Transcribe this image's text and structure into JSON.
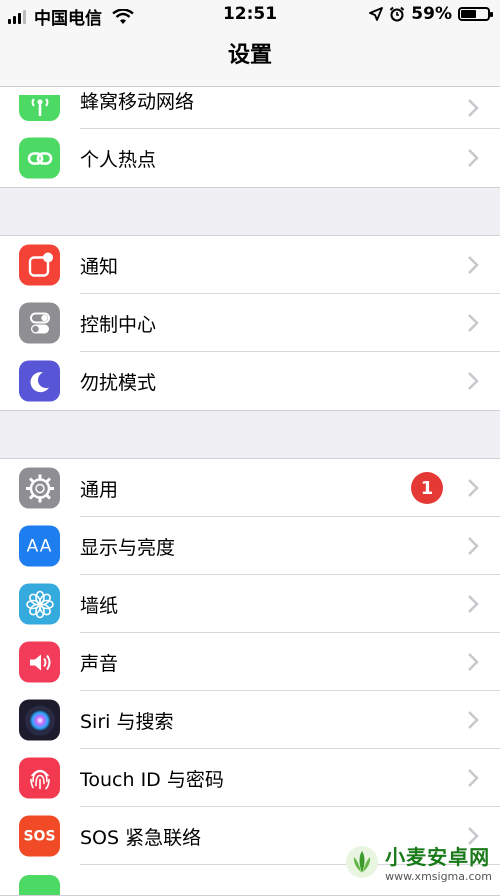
{
  "status": {
    "carrier": "中国电信",
    "time": "12:51",
    "battery_percent": "59%",
    "battery_level": 0.59
  },
  "nav": {
    "title": "设置"
  },
  "groups": [
    {
      "rows": [
        {
          "label": "蜂窝移动网络",
          "icon": "cellular-antenna-icon",
          "color": "#4cd964"
        },
        {
          "label": "个人热点",
          "icon": "personal-hotspot-icon",
          "color": "#4cd964"
        }
      ]
    },
    {
      "rows": [
        {
          "label": "通知",
          "icon": "notifications-icon",
          "color": "#f44336"
        },
        {
          "label": "控制中心",
          "icon": "control-center-icon",
          "color": "#8e8e93"
        },
        {
          "label": "勿扰模式",
          "icon": "moon-icon",
          "color": "#5856d6"
        }
      ]
    },
    {
      "rows": [
        {
          "label": "通用",
          "icon": "gear-icon",
          "color": "#8e8e93",
          "badge": "1"
        },
        {
          "label": "显示与亮度",
          "icon": "display-brightness-icon",
          "color": "#1e7ef0",
          "icon_text": "AA"
        },
        {
          "label": "墙纸",
          "icon": "wallpaper-flower-icon",
          "color": "#35aadc"
        },
        {
          "label": "声音",
          "icon": "speaker-icon",
          "color": "#f23c5a"
        },
        {
          "label": "Siri 与搜索",
          "icon": "siri-icon",
          "color": "#1c1c2e"
        },
        {
          "label": "Touch ID 与密码",
          "icon": "fingerprint-icon",
          "color": "#f2394f"
        },
        {
          "label": "SOS 紧急联络",
          "icon": "sos-icon",
          "color": "#f04a26",
          "icon_text": "SOS"
        }
      ]
    }
  ],
  "watermark": {
    "title": "小麦安卓网",
    "url": "www.xmsigma.com"
  }
}
